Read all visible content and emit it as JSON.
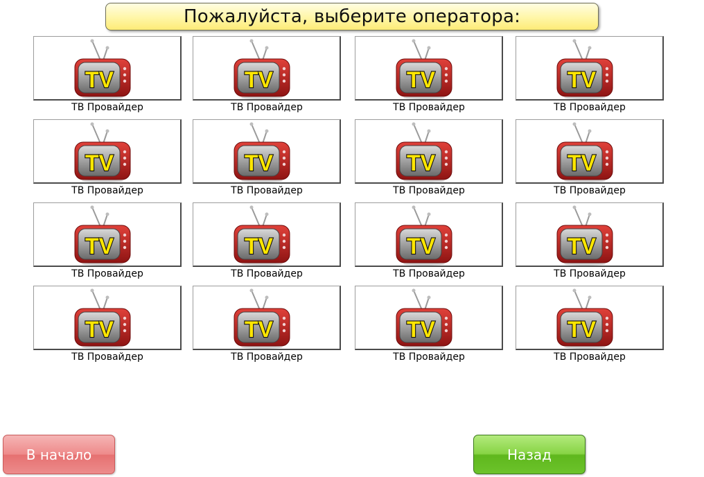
{
  "header": {
    "title": "Пожалуйста, выберите оператора:"
  },
  "operators": [
    {
      "label": "ТВ Провайдер",
      "icon": "tv-icon",
      "logo_text": "TV"
    },
    {
      "label": "ТВ Провайдер",
      "icon": "tv-icon",
      "logo_text": "TV"
    },
    {
      "label": "ТВ Провайдер",
      "icon": "tv-icon",
      "logo_text": "TV"
    },
    {
      "label": "ТВ Провайдер",
      "icon": "tv-icon",
      "logo_text": "TV"
    },
    {
      "label": "ТВ Провайдер",
      "icon": "tv-icon",
      "logo_text": "TV"
    },
    {
      "label": "ТВ Провайдер",
      "icon": "tv-icon",
      "logo_text": "TV"
    },
    {
      "label": "ТВ Провайдер",
      "icon": "tv-icon",
      "logo_text": "TV"
    },
    {
      "label": "ТВ Провайдер",
      "icon": "tv-icon",
      "logo_text": "TV"
    },
    {
      "label": "ТВ Провайдер",
      "icon": "tv-icon",
      "logo_text": "TV"
    },
    {
      "label": "ТВ Провайдер",
      "icon": "tv-icon",
      "logo_text": "TV"
    },
    {
      "label": "ТВ Провайдер",
      "icon": "tv-icon",
      "logo_text": "TV"
    },
    {
      "label": "ТВ Провайдер",
      "icon": "tv-icon",
      "logo_text": "TV"
    },
    {
      "label": "ТВ Провайдер",
      "icon": "tv-icon",
      "logo_text": "TV"
    },
    {
      "label": "ТВ Провайдер",
      "icon": "tv-icon",
      "logo_text": "TV"
    },
    {
      "label": "ТВ Провайдер",
      "icon": "tv-icon",
      "logo_text": "TV"
    },
    {
      "label": "ТВ Провайдер",
      "icon": "tv-icon",
      "logo_text": "TV"
    }
  ],
  "footer": {
    "home_label": "В начало",
    "back_label": "Назад"
  },
  "colors": {
    "banner": "#fff6a6",
    "home_button": "#ee8a8a",
    "back_button": "#6cc32b",
    "tv_body": "#c0211f",
    "tv_logo": "#ffe600"
  }
}
